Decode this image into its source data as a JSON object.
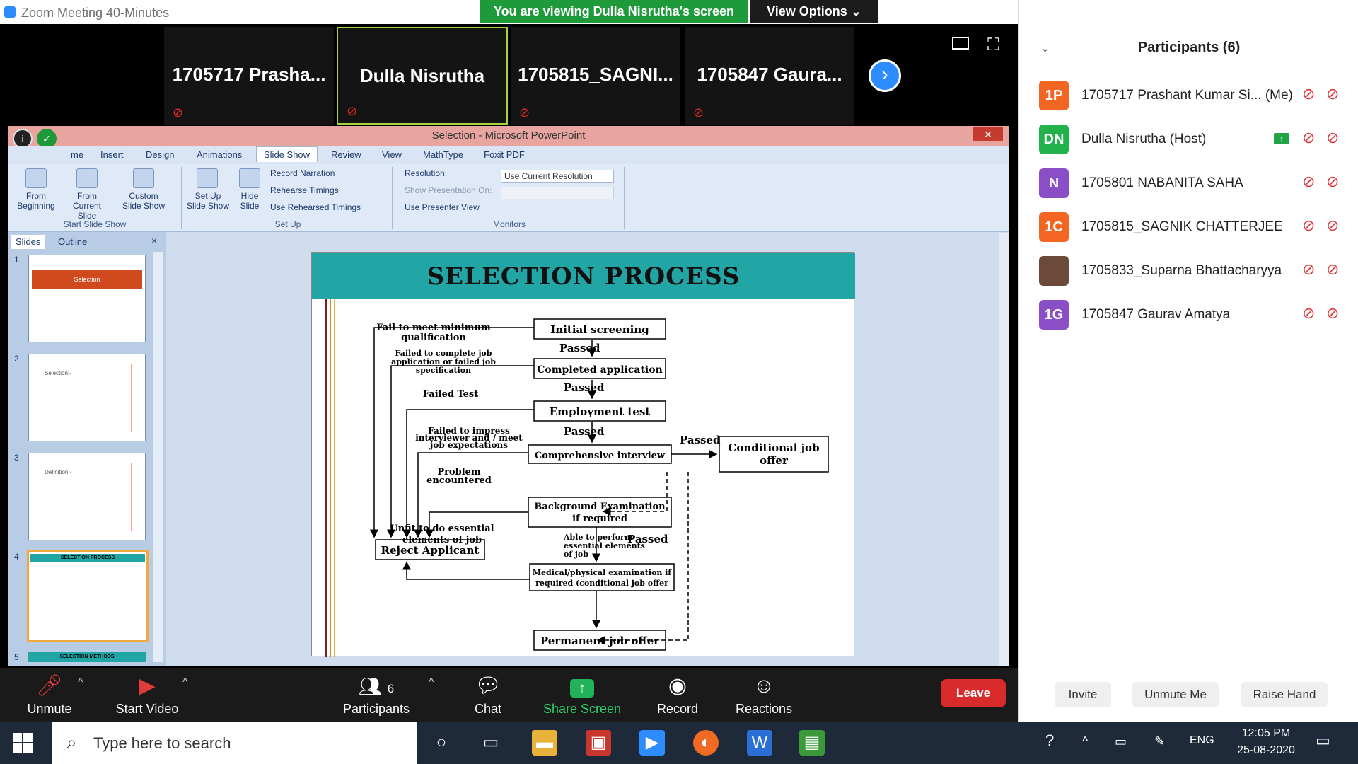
{
  "zoom": {
    "window_title": "Zoom Meeting 40-Minutes",
    "viewing_banner": "You are viewing Dulla Nisrutha's screen",
    "view_options": "View Options ⌄",
    "minimize": "—",
    "restore": "❐",
    "close": "✕",
    "tiles": [
      {
        "name": "1705717  Prasha..."
      },
      {
        "name": "Dulla Nisrutha"
      },
      {
        "name": "1705815_SAGNI..."
      },
      {
        "name": "1705847  Gaura..."
      }
    ],
    "next_arrow": "›",
    "fullscreen": "⛶",
    "muted_mic": "🎤"
  },
  "ppt": {
    "title": "Selection - Microsoft PowerPoint",
    "close": "✕",
    "tabs": [
      "me",
      "Insert",
      "Design",
      "Animations",
      "Slide Show",
      "Review",
      "View",
      "MathType",
      "Foxit PDF"
    ],
    "ribbon": {
      "from_beginning": "From Beginning",
      "from_current": "From Current Slide",
      "custom_show": "Custom Slide Show",
      "start_group": "Start Slide Show",
      "set_up_show": "Set Up Slide Show",
      "hide_slide": "Hide Slide",
      "record_narration": "Record Narration",
      "rehearse": "Rehearse Timings",
      "use_rehearsed": "Use Rehearsed Timings",
      "setup_group": "Set Up",
      "resolution": "Resolution:",
      "resolution_value": "Use Current Resolution",
      "show_on": "Show Presentation On:",
      "presenter_view": "Use Presenter View",
      "monitors_group": "Monitors"
    },
    "pane_tabs": [
      "Slides",
      "Outline"
    ],
    "pane_close": "×",
    "thumbnails": [
      {
        "num": "1",
        "title": "Selection"
      },
      {
        "num": "2",
        "title": "Selection:-"
      },
      {
        "num": "3",
        "title": "Definition:-"
      },
      {
        "num": "4",
        "title": "SELECTION PROCESS"
      },
      {
        "num": "5",
        "title": "SELECTION METHODS"
      }
    ],
    "slide": {
      "title": "SELECTION PROCESS",
      "boxes": {
        "initial": "Initial screening",
        "completed": "Completed application",
        "employment": "Employment test",
        "interview": "Comprehensive interview",
        "conditional1": "Conditional job",
        "conditional2": "offer",
        "background1": "Background Examination",
        "background2": "if required",
        "medical1": "Medical/physical examination if",
        "medical2": "required (conditional job offer",
        "permanent": "Permanent job offer",
        "reject": "Reject Applicant"
      },
      "labels": {
        "passed": "Passed",
        "fail_min1": "Fail to meet minimum",
        "fail_min2": "qualification",
        "failed_complete1": "Failed to complete job",
        "failed_complete2": "application or failed job",
        "failed_complete3": "specification",
        "failed_test": "Failed Test",
        "impress1": "Failed to impress",
        "impress2": "interviewer and / meet",
        "impress3": "job expectations",
        "problem1": "Problem",
        "problem2": "encountered",
        "unfit1": "Unfit to do essential",
        "unfit2": "elements of job",
        "able1": "Able to perform",
        "able2": "essential elements",
        "able3": "of job"
      }
    }
  },
  "toolbar": {
    "unmute": "Unmute",
    "start_video": "Start Video",
    "participants": "Participants",
    "participants_count": "6",
    "chat": "Chat",
    "share_screen": "Share Screen",
    "record": "Record",
    "reactions": "Reactions",
    "leave": "Leave"
  },
  "participants": {
    "title": "Participants (6)",
    "list": [
      {
        "initials": "1P",
        "name": "1705717 Prashant Kumar Si...  (Me)",
        "color": "#f26522"
      },
      {
        "initials": "DN",
        "name": "Dulla Nisrutha (Host)",
        "color": "#21b24b"
      },
      {
        "initials": "N",
        "name": "1705801 NABANITA SAHA",
        "color": "#8a4fc7"
      },
      {
        "initials": "1C",
        "name": "1705815_SAGNIK CHATTERJEE",
        "color": "#f26522"
      },
      {
        "initials": "",
        "name": "1705833_Suparna Bhattacharyya",
        "color": "#6b4a3a"
      },
      {
        "initials": "1G",
        "name": "1705847 Gaurav Amatya",
        "color": "#8a4fc7"
      }
    ],
    "invite": "Invite",
    "unmute_me": "Unmute Me",
    "raise_hand": "Raise Hand"
  },
  "taskbar": {
    "search_placeholder": "Type here to search",
    "language": "ENG",
    "time": "12:05 PM",
    "date": "25-08-2020"
  }
}
